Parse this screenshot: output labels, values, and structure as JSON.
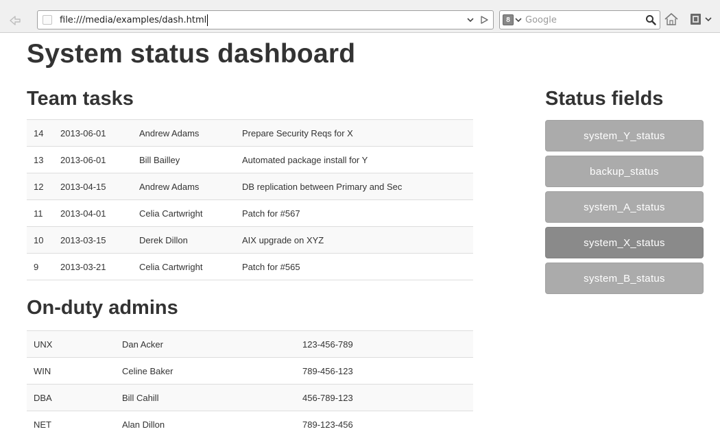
{
  "browser": {
    "url": "file:///media/examples/dash.html",
    "search_placeholder": "Google",
    "search_engine_glyph": "8"
  },
  "page": {
    "title": "System status dashboard",
    "tasks_heading": "Team tasks",
    "admins_heading": "On-duty admins",
    "status_heading": "Status fields"
  },
  "tasks": [
    {
      "id": "14",
      "date": "2013-06-01",
      "owner": "Andrew Adams",
      "task": "Prepare Security Reqs for X"
    },
    {
      "id": "13",
      "date": "2013-06-01",
      "owner": "Bill Bailley",
      "task": "Automated package install for Y"
    },
    {
      "id": "12",
      "date": "2013-04-15",
      "owner": "Andrew Adams",
      "task": "DB replication between Primary and Sec"
    },
    {
      "id": "11",
      "date": "2013-04-01",
      "owner": "Celia Cartwright",
      "task": "Patch for #567"
    },
    {
      "id": "10",
      "date": "2013-03-15",
      "owner": "Derek Dillon",
      "task": "AIX upgrade on XYZ"
    },
    {
      "id": "9",
      "date": "2013-03-21",
      "owner": "Celia Cartwright",
      "task": "Patch for #565"
    }
  ],
  "admins": [
    {
      "team": "UNX",
      "name": "Dan Acker",
      "phone": "123-456-789"
    },
    {
      "team": "WIN",
      "name": "Celine Baker",
      "phone": "789-456-123"
    },
    {
      "team": "DBA",
      "name": "Bill Cahill",
      "phone": "456-789-123"
    },
    {
      "team": "NET",
      "name": "Alan Dillon",
      "phone": "789-123-456"
    }
  ],
  "status_fields": [
    {
      "label": "system_Y_status",
      "color": "#ababab"
    },
    {
      "label": "backup_status",
      "color": "#ababab"
    },
    {
      "label": "system_A_status",
      "color": "#ababab"
    },
    {
      "label": "system_X_status",
      "color": "#8a8a8a"
    },
    {
      "label": "system_B_status",
      "color": "#ababab"
    }
  ],
  "icons": {
    "back": "back-arrow-icon",
    "page": "page-icon",
    "dropdown": "chevron-down-icon",
    "go": "go-arrow-icon",
    "search": "search-icon",
    "home": "home-icon",
    "bookmarks": "bookmarks-icon"
  }
}
